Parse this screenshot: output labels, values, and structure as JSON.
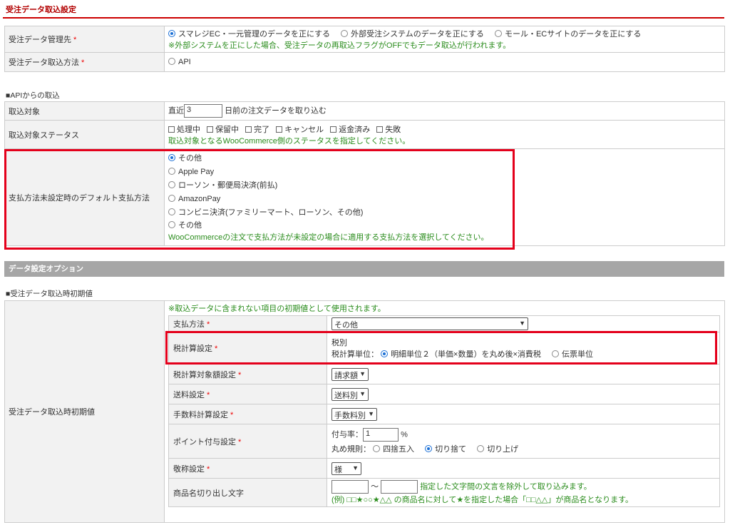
{
  "section_title": "受注データ取込設定",
  "rows_top": {
    "mgmt": {
      "label": "受注データ管理先",
      "req": "*",
      "options": [
        "スマレジEC・一元管理のデータを正にする",
        "外部受注システムのデータを正にする",
        "モール・ECサイトのデータを正にする"
      ],
      "note": "※外部システムを正にした場合、受注データの再取込フラグがOFFでもデータ取込が行われます。"
    },
    "method": {
      "label": "受注データ取込方法",
      "req": "*",
      "option": "API"
    }
  },
  "api_heading": "■APIからの取込",
  "api": {
    "target": {
      "label": "取込対象",
      "prefix": "直近",
      "days": "3",
      "suffix": "日前の注文データを取り込む"
    },
    "status": {
      "label": "取込対象ステータス",
      "checks": [
        "処理中",
        "保留中",
        "完了",
        "キャンセル",
        "返金済み",
        "失敗"
      ],
      "note": "取込対象となるWooCommerce側のステータスを指定してください。"
    },
    "payment": {
      "label": "支払方法未設定時のデフォルト支払方法",
      "options": [
        "その他",
        "Apple Pay",
        "ローソン・郵便局決済(前払)",
        "AmazonPay",
        "コンビニ決済(ファミリーマート、ローソン、その他)",
        "その他"
      ],
      "note": "WooCommerceの注文で支払方法が未設定の場合に適用する支払方法を選択してください。"
    }
  },
  "band_title": "データ設定オプション",
  "init_heading": "■受注データ取込時初期値",
  "init": {
    "label": "受注データ取込時初期値",
    "note": "※取込データに含まれない項目の初期値として使用されます。",
    "pay": {
      "label": "支払方法",
      "req": "*",
      "value": "その他"
    },
    "tax": {
      "label": "税計算設定",
      "req": "*",
      "line1": "税別",
      "unit_label": "税計算単位：",
      "opt1": "明細単位２（単価×数量）を丸め後×消費税",
      "opt2": "伝票単位"
    },
    "taxbase": {
      "label": "税計算対象額設定",
      "req": "*",
      "value": "請求額"
    },
    "ship": {
      "label": "送料設定",
      "req": "*",
      "value": "送料別"
    },
    "fee": {
      "label": "手数料計算設定",
      "req": "*",
      "value": "手数料別"
    },
    "point": {
      "label": "ポイント付与設定",
      "req": "*",
      "rate_label": "付与率：",
      "rate": "1",
      "unit": "%",
      "round_label": "丸め規則：",
      "round_opts": [
        "四捨五入",
        "切り捨て",
        "切り上げ"
      ]
    },
    "honor": {
      "label": "敬称設定",
      "req": "*",
      "value": "様"
    },
    "cut": {
      "label": "商品名切り出し文字",
      "tilde": "～",
      "desc": "指定した文字間の文言を除外して取り込みます。",
      "example": "(例) □□★○○★△△ の商品名に対して★を指定した場合「□□△△」が商品名となります。"
    }
  }
}
